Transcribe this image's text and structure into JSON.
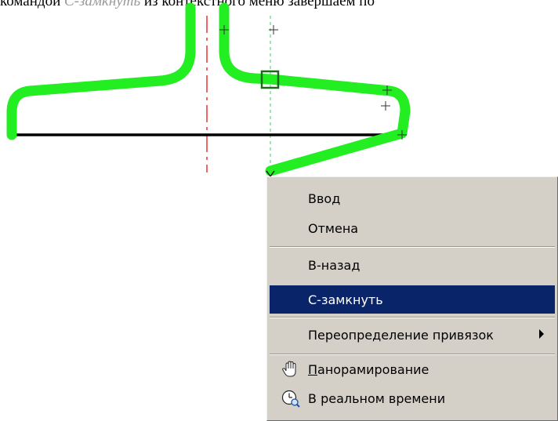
{
  "caption": {
    "prefix": "командой ",
    "command": "С-замкнуть",
    "suffix": " из контекстного меню завершаем по"
  },
  "drawing": {
    "outline_color": "#22ee22",
    "axis_color": "#ee3333",
    "guide_color": "#44cc66",
    "base_line_color": "#000000"
  },
  "context_menu": {
    "items": [
      {
        "label": "Ввод"
      },
      {
        "label": "Отмена"
      },
      {
        "label": "В-назад"
      },
      {
        "label": "С-замкнуть",
        "highlighted": true
      },
      {
        "label": "Переопределение привязок",
        "has_submenu": true
      },
      {
        "label_first_letter": "П",
        "label_rest": "анорамирование",
        "icon": "hand-pan-icon"
      },
      {
        "label": "В реальном времени",
        "icon": "realtime-zoom-icon"
      }
    ],
    "highlight_color": "#0a246a"
  }
}
